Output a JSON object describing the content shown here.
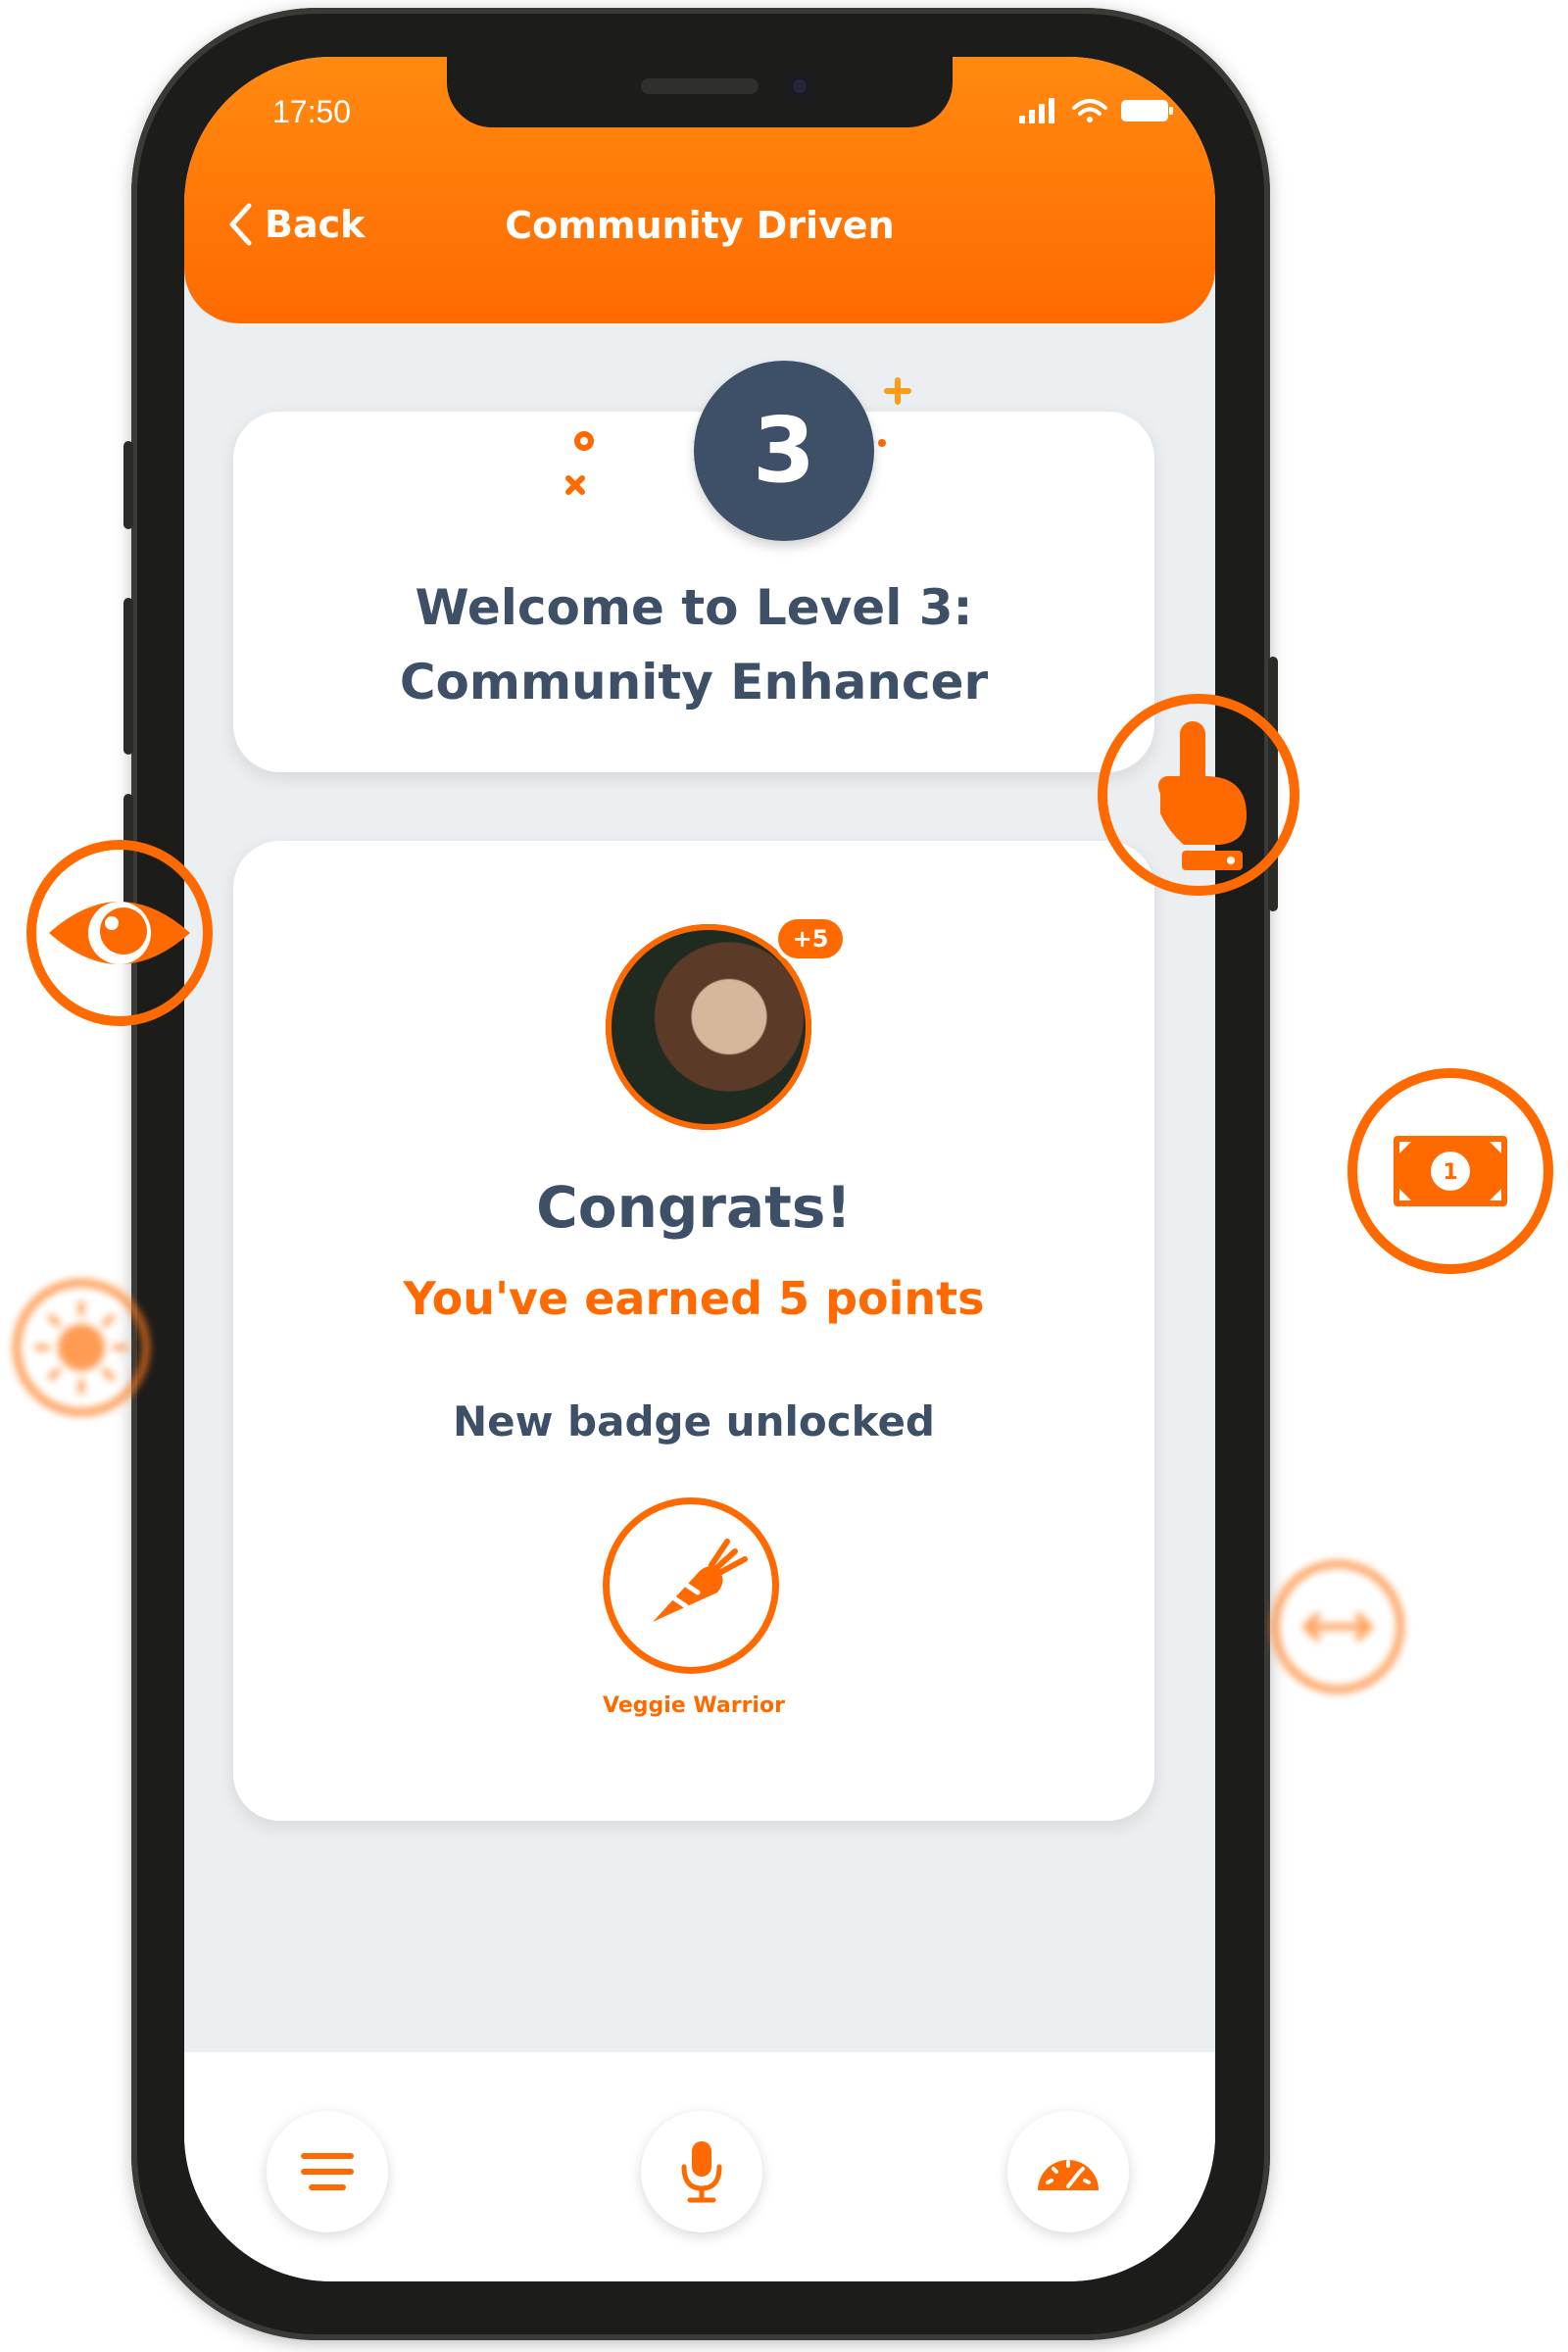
{
  "status_bar": {
    "time": "17:50"
  },
  "header": {
    "back_label": "Back",
    "title": "Community Driven"
  },
  "level": {
    "number": "3",
    "title_line1": "Welcome to Level 3:",
    "title_line2": "Community Enhancer"
  },
  "reward": {
    "points_badge": "+5",
    "congrats": "Congrats!",
    "points_text": "You've earned 5 points",
    "badge_heading": "New badge unlocked",
    "badge_name": "Veggie Warrior"
  },
  "colors": {
    "accent": "#ff6a00",
    "navy": "#3d5068",
    "background": "#eceff2"
  },
  "icons": {
    "menu": "menu-icon",
    "mic": "microphone-icon",
    "gauge": "speedometer-icon",
    "badge": "carrot-icon",
    "floating": [
      "eye-icon",
      "hand-pointer-icon",
      "banknote-icon",
      "sun-icon",
      "arrows-icon"
    ]
  }
}
